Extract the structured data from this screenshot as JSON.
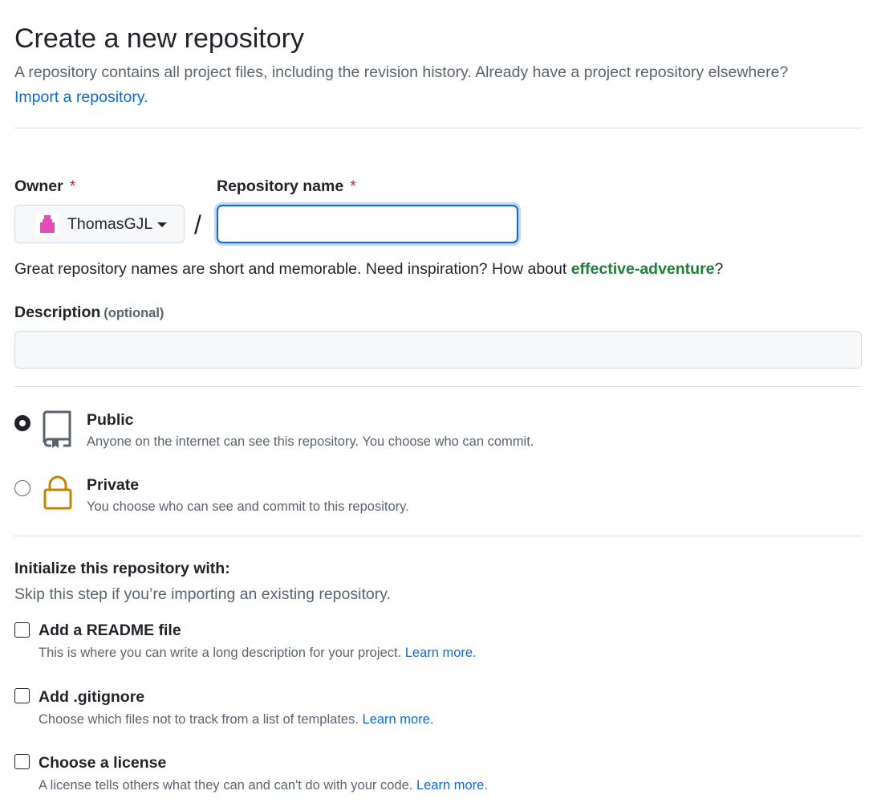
{
  "header": {
    "title": "Create a new repository",
    "intro": "A repository contains all project files, including the revision history. Already have a project repository elsewhere?",
    "import_link": "Import a repository."
  },
  "owner": {
    "label": "Owner",
    "required_mark": "*",
    "selected": "ThomasGJL",
    "avatar_icon": "pink-identicon-avatar"
  },
  "repo_name": {
    "label": "Repository name",
    "required_mark": "*",
    "value": "",
    "placeholder": ""
  },
  "separator": "/",
  "name_hint": {
    "text": "Great repository names are short and memorable. Need inspiration? How about ",
    "suggestion": "effective-adventure",
    "suffix": "?"
  },
  "description": {
    "label": "Description",
    "optional_label": "(optional)",
    "value": "",
    "placeholder": ""
  },
  "visibility": {
    "public": {
      "title": "Public",
      "description": "Anyone on the internet can see this repository. You choose who can commit.",
      "icon": "repo-icon",
      "checked": true
    },
    "private": {
      "title": "Private",
      "description": "You choose who can see and commit to this repository.",
      "icon": "lock-icon",
      "checked": false
    }
  },
  "initialize": {
    "title": "Initialize this repository with:",
    "subtitle": "Skip this step if you’re importing an existing repository.",
    "options": [
      {
        "label": "Add a README file",
        "description": "This is where you can write a long description for your project.",
        "link": "Learn more.",
        "checked": false
      },
      {
        "label": "Add .gitignore",
        "description": "Choose which files not to track from a list of templates.",
        "link": "Learn more.",
        "checked": false
      },
      {
        "label": "Choose a license",
        "description": "A license tells others what they can and can't do with your code.",
        "link": "Learn more.",
        "checked": false
      }
    ]
  },
  "colors": {
    "link": "#0969da",
    "required": "#d1242f",
    "suggestion": "#1a7f37",
    "lock_icon": "#bf8700",
    "avatar": "#e14dba"
  }
}
